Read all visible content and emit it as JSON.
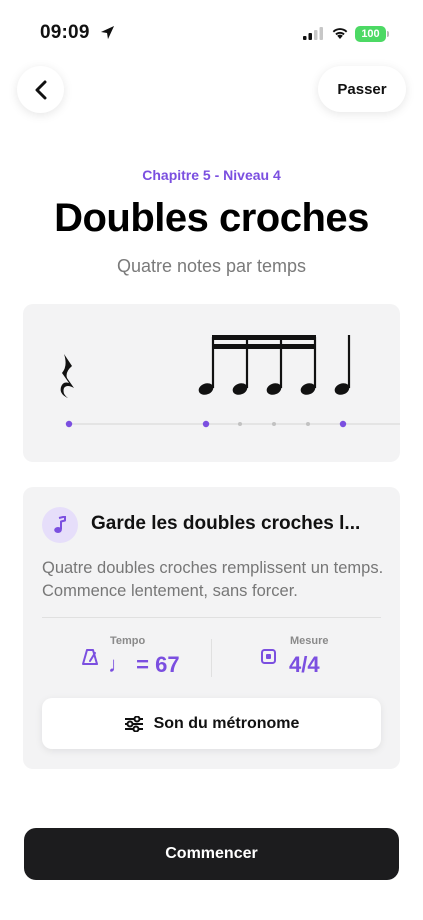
{
  "status_bar": {
    "time": "09:09",
    "battery": "100",
    "icons": [
      "location-arrow-icon",
      "cellular-signal-icon",
      "wifi-icon",
      "battery-icon"
    ],
    "battery_color": "#4cd964"
  },
  "header": {
    "back_icon": "chevron-left-icon",
    "skip_label": "Passer"
  },
  "lesson": {
    "chapter": "Chapitre 5 - Niveau 4",
    "title": "Doubles croches",
    "subtitle": "Quatre notes par temps"
  },
  "notation": {
    "elements": [
      "quarter-rest",
      "four-sixteenth-notes-beamed",
      "quarter-note"
    ],
    "timeline_dots": 6
  },
  "info_card": {
    "icon": "music-note-icon",
    "title": "Garde les doubles croches l...",
    "description": "Quatre doubles croches remplissent un temps. Commence lentement, sans forcer.",
    "tempo": {
      "label": "Tempo",
      "note_glyph": "♩",
      "value": "= 67",
      "icon": "metronome-icon"
    },
    "measure": {
      "label": "Mesure",
      "value": "4/4",
      "icon": "time-signature-icon"
    },
    "metronome_button": {
      "label": "Son du métronome",
      "icon": "sliders-icon"
    }
  },
  "footer": {
    "start_label": "Commencer"
  },
  "colors": {
    "accent": "#7b4fe0",
    "accent_light": "#e6defa",
    "card_bg": "#f3f3f4",
    "primary_button": "#1c1c1e"
  }
}
